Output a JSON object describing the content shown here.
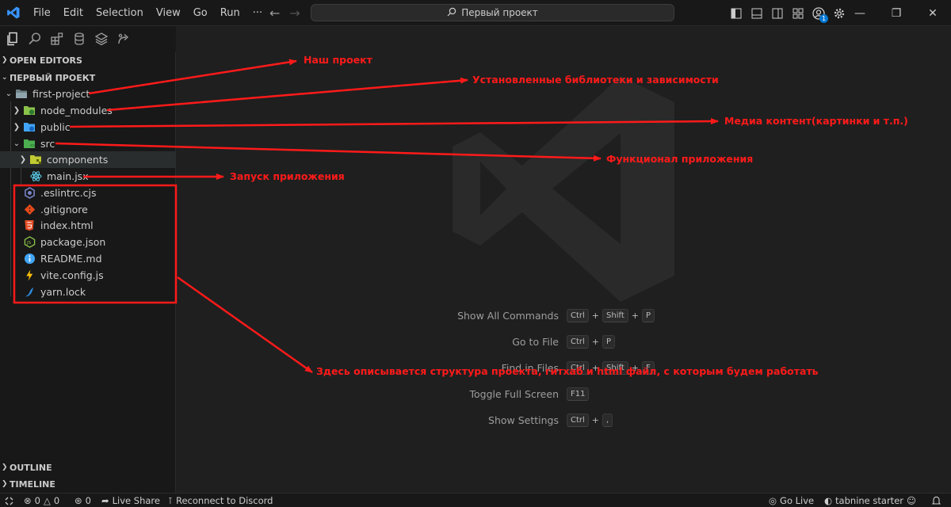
{
  "titlebar": {
    "menu": [
      "File",
      "Edit",
      "Selection",
      "View",
      "Go",
      "Run",
      "···"
    ],
    "search_text": "Первый проект",
    "notification_count": "1"
  },
  "sidebar": {
    "open_editors": "OPEN EDITORS",
    "project_header": "ПЕРВЫЙ ПРОЕКТ",
    "tree": [
      {
        "label": "first-project"
      },
      {
        "label": "node_modules"
      },
      {
        "label": "public"
      },
      {
        "label": "src"
      },
      {
        "label": "components"
      },
      {
        "label": "main.jsx"
      },
      {
        "label": ".eslintrc.cjs"
      },
      {
        "label": ".gitignore"
      },
      {
        "label": "index.html"
      },
      {
        "label": "package.json"
      },
      {
        "label": "README.md"
      },
      {
        "label": "vite.config.js"
      },
      {
        "label": "yarn.lock"
      }
    ],
    "outline": "OUTLINE",
    "timeline": "TIMELINE"
  },
  "commands": [
    {
      "label": "Show All Commands",
      "keys": [
        "Ctrl",
        "Shift",
        "P"
      ]
    },
    {
      "label": "Go to File",
      "keys": [
        "Ctrl",
        "P"
      ]
    },
    {
      "label": "Find in Files",
      "keys": [
        "Ctrl",
        "Shift",
        "F"
      ]
    },
    {
      "label": "Toggle Full Screen",
      "keys": [
        "F11"
      ]
    },
    {
      "label": "Show Settings",
      "keys": [
        "Ctrl",
        ","
      ]
    }
  ],
  "annotations": {
    "project": "Наш проект",
    "libs": "Установленные библиотеки и зависимости",
    "media": "Медиа контент(картинки и т.п.)",
    "src": "Функционал приложения",
    "main": "Запуск приложения",
    "structure": "Здесь описывается структура проекта, гитхаб и html файл, с которым будем работать"
  },
  "statusbar": {
    "errors": "0",
    "warnings": "0",
    "ports": "0",
    "live_share": "Live Share",
    "discord": "Reconnect to Discord",
    "go_live": "Go Live",
    "tabnine": "tabnine starter"
  },
  "colors": {
    "annotation": "#ff1a1a",
    "accent": "#3794ff",
    "background": "#1f1f1f",
    "sidebar": "#181818"
  }
}
